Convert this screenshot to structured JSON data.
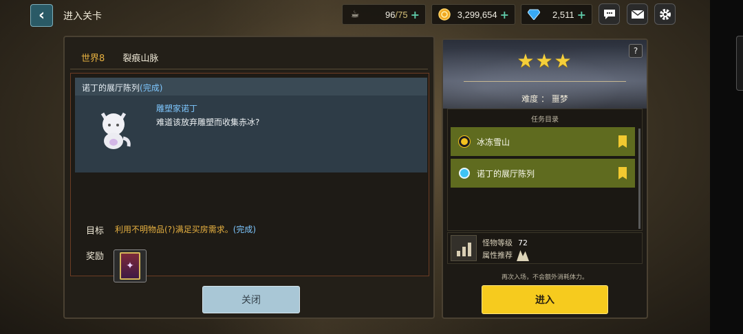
{
  "header": {
    "back_label": "‹",
    "title": "进入关卡"
  },
  "resources": {
    "stamina": {
      "value": "96",
      "max": "/75",
      "icon": "coffee-cup-icon"
    },
    "gold": {
      "value": "3,299,654",
      "icon": "gold-coin-icon"
    },
    "gems": {
      "value": "2,511",
      "icon": "diamond-icon"
    },
    "plus": "+"
  },
  "top_icons": [
    "chat-bubble-icon",
    "mail-icon",
    "settings-gear-icon"
  ],
  "left": {
    "world": "世界8",
    "area": "裂痕山脉",
    "quest_title": "诺丁的展厅陈列",
    "quest_status": "(完成)",
    "npc_name": "雕塑家诺丁",
    "npc_line": "难道该放弃雕塑而收集赤冰?",
    "goal_label": "目标",
    "goal_text": "利用不明物品(?)满足买房需求。",
    "goal_status": "(完成)",
    "reward_label": "奖励",
    "close_label": "关闭"
  },
  "right": {
    "help": "?",
    "stars": "★★★",
    "difficulty": "难度 ： 噩梦",
    "mission_title": "任务目录",
    "missions": [
      {
        "label": "冰冻雪山"
      },
      {
        "label": "诺丁的展厅陈列"
      }
    ],
    "monster_level_label": "怪物等级",
    "monster_level": "72",
    "attr_label": "属性推荐",
    "note": "再次入场，不会额外消耗体力。",
    "enter_label": "进入"
  },
  "colors": {
    "accent_yellow": "#f6cb1e",
    "mission_green": "#5f6b1f",
    "complete_blue": "#7ec7ff",
    "world_orange": "#e6b040"
  }
}
